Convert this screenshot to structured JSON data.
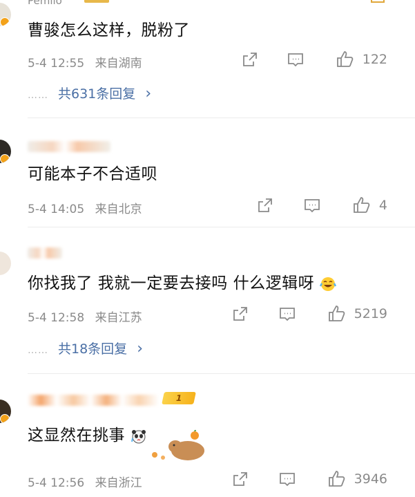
{
  "comments": [
    {
      "username": "Pemiio",
      "text": "曹骏怎么这样，脱粉了",
      "date": "5-4 12:55",
      "location": "来自湖南",
      "likes": "122",
      "replies": "共631条回复"
    },
    {
      "text": "可能本子不合适呗",
      "date": "5-4 14:05",
      "location": "来自北京",
      "likes": "4"
    },
    {
      "text": "你找我了 我就一定要去接吗 什么逻辑呀",
      "date": "5-4 12:58",
      "location": "来自江苏",
      "likes": "5219",
      "replies": "共18条回复"
    },
    {
      "text": "这显然在挑事",
      "date": "5-4 12:56",
      "location": "来自浙江",
      "likes": "3946",
      "level": "1"
    }
  ],
  "dots": "……",
  "chevron": "›",
  "icons": [
    "share-icon",
    "comment-icon",
    "like-icon",
    "avatar-badge-icon",
    "laughing-crying-emoji",
    "panda-emoji",
    "capybara-sticker"
  ]
}
